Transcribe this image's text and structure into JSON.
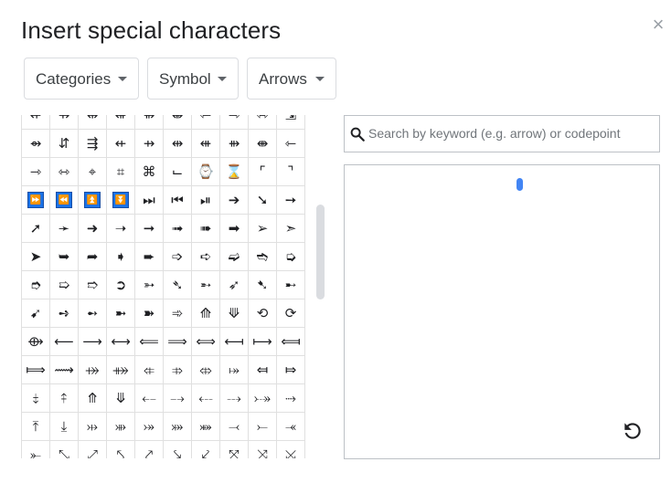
{
  "dialog": {
    "title": "Insert special characters",
    "close_label": "×"
  },
  "filters": {
    "categories": "Categories",
    "type": "Symbol",
    "subtype": "Arrows"
  },
  "search": {
    "placeholder": "Search by keyword (e.g. arrow) or codepoint",
    "value": ""
  },
  "colors": {
    "selected_bg": "#1a73e8",
    "scrollbar": "#dadce0",
    "drawing_dot": "#4285f4"
  },
  "grid": {
    "rows": [
      [
        "⇷",
        "⇸",
        "⇹",
        "⇺",
        "⇻",
        "⇼",
        "⇽",
        "⇾",
        "⇿",
        "⇲"
      ],
      [
        "⇴",
        "⇵",
        "⇶",
        "⇷",
        "⇸",
        "⇹",
        "⇺",
        "⇻",
        "⇼",
        "⇽"
      ],
      [
        "⇾",
        "⇿",
        "⌖",
        "⌗",
        "⌘",
        "⌙",
        "⌚",
        "⌛",
        "⌜",
        "⌝"
      ],
      [
        "⏩",
        "⏪",
        "⏫",
        "⏬",
        "⏭",
        "⏮",
        "⏯",
        "➔",
        "➘",
        "➙"
      ],
      [
        "➚",
        "➛",
        "➜",
        "➝",
        "➞",
        "➟",
        "➠",
        "➡",
        "➢",
        "➣"
      ],
      [
        "➤",
        "➥",
        "➦",
        "➧",
        "➨",
        "➩",
        "➪",
        "➫",
        "➬",
        "➭"
      ],
      [
        "➮",
        "➯",
        "➱",
        "➲",
        "➳",
        "➴",
        "➵",
        "➶",
        "➷",
        "➸"
      ],
      [
        "➹",
        "➺",
        "➻",
        "➼",
        "➽",
        "➾",
        "⟰",
        "⟱",
        "⟲",
        "⟳"
      ],
      [
        "⟴",
        "⟵",
        "⟶",
        "⟷",
        "⟸",
        "⟹",
        "⟺",
        "⟻",
        "⟼",
        "⟽"
      ],
      [
        "⟾",
        "⟿",
        "⤀",
        "⤁",
        "⤂",
        "⤃",
        "⤄",
        "⤅",
        "⤆",
        "⤇"
      ],
      [
        "⤈",
        "⤉",
        "⤊",
        "⤋",
        "⤌",
        "⤍",
        "⤎",
        "⤏",
        "⤐",
        "⤑"
      ],
      [
        "⤒",
        "⤓",
        "⤔",
        "⤕",
        "⤖",
        "⤗",
        "⤘",
        "⤙",
        "⤚",
        "⤛"
      ],
      [
        "⤜",
        "⤡",
        "⤢",
        "⤣",
        "⤤",
        "⤥",
        "⤦",
        "⤧",
        "⤨",
        "⤩"
      ]
    ],
    "selected": [
      [
        3,
        0
      ],
      [
        3,
        1
      ],
      [
        3,
        2
      ],
      [
        3,
        3
      ]
    ]
  }
}
